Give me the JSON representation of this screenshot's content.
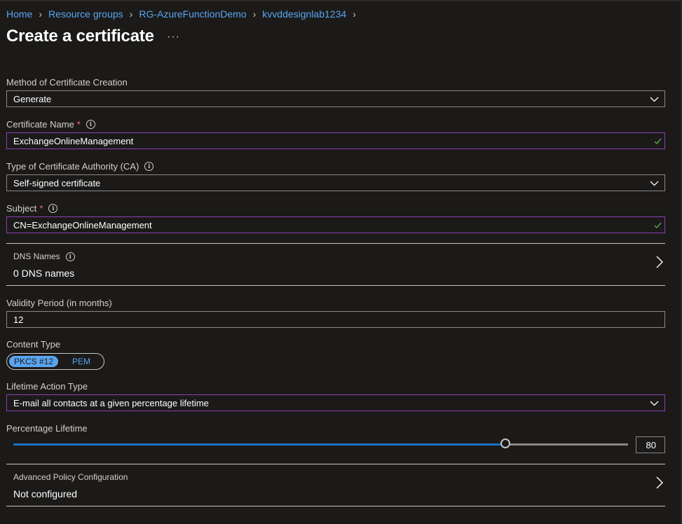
{
  "breadcrumb": [
    "Home",
    "Resource groups",
    "RG-AzureFunctionDemo",
    "kvvddesignlab1234"
  ],
  "title": "Create a certificate",
  "more_label": "···",
  "method": {
    "label": "Method of Certificate Creation",
    "value": "Generate"
  },
  "cert_name": {
    "label": "Certificate Name",
    "required": "*",
    "value": "ExchangeOnlineManagement"
  },
  "ca_type": {
    "label": "Type of Certificate Authority (CA)",
    "value": "Self-signed certificate"
  },
  "subject": {
    "label": "Subject",
    "required": "*",
    "value": "CN=ExchangeOnlineManagement"
  },
  "dns": {
    "label": "DNS Names",
    "value": "0 DNS names"
  },
  "validity": {
    "label": "Validity Period (in months)",
    "value": "12"
  },
  "content_type": {
    "label": "Content Type",
    "options": [
      "PKCS #12",
      "PEM"
    ],
    "selected": "PKCS #12"
  },
  "lifetime_action": {
    "label": "Lifetime Action Type",
    "value": "E-mail all contacts at a given percentage lifetime"
  },
  "percentage": {
    "label": "Percentage Lifetime",
    "value": "80",
    "fraction": 0.8
  },
  "advanced": {
    "label": "Advanced Policy Configuration",
    "value": "Not configured"
  },
  "info_glyph": "i",
  "colors": {
    "link": "#5aa5f0",
    "focus_border": "#8a3fb1",
    "valid_check": "#57a64a",
    "required": "#ff6b6b",
    "slider_fill": "#1a70c2"
  }
}
